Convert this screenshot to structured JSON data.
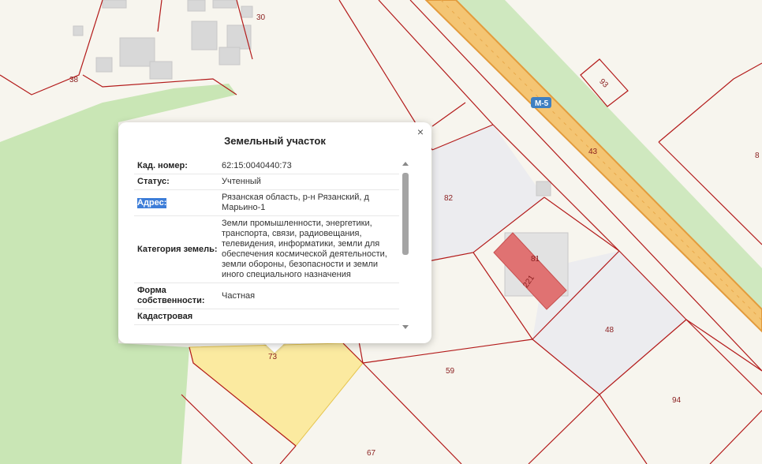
{
  "map": {
    "plot_numbers": [
      "30",
      "38",
      "93",
      "43",
      "82",
      "81",
      "221",
      "48",
      "59",
      "94",
      "67",
      "73",
      "8"
    ],
    "road_label": "М-5",
    "colors": {
      "background": "#f7f5ee",
      "forest": "#c9e6b5",
      "road_fill": "#f4c573",
      "road_edge": "#e39b3c",
      "boundary": "#b31a1a",
      "selected_plot": "#fbeaa0",
      "building": "#d8d8d8",
      "building_highlight": "#e07272",
      "grey_plot": "#ececef"
    }
  },
  "popup": {
    "title": "Земельный участок",
    "close_glyph": "×",
    "rows": [
      {
        "key": "Кад. номер:",
        "value": "62:15:0040440:73"
      },
      {
        "key": "Статус:",
        "value": "Учтенный"
      },
      {
        "key": "Адрес:",
        "value": "Рязанская область, р-н Рязанский, д Марьино-1"
      },
      {
        "key": "Категория земель:",
        "value": "Земли промышленности, энергетики, транспорта, связи, радиовещания, телевидения, информатики, земли для обеспечения космической деятельности, земли обороны, безопасности и земли иного специального назначения"
      },
      {
        "key": "Форма собственности:",
        "value": "Частная"
      },
      {
        "key": "Кадастровая",
        "value": ""
      }
    ]
  }
}
